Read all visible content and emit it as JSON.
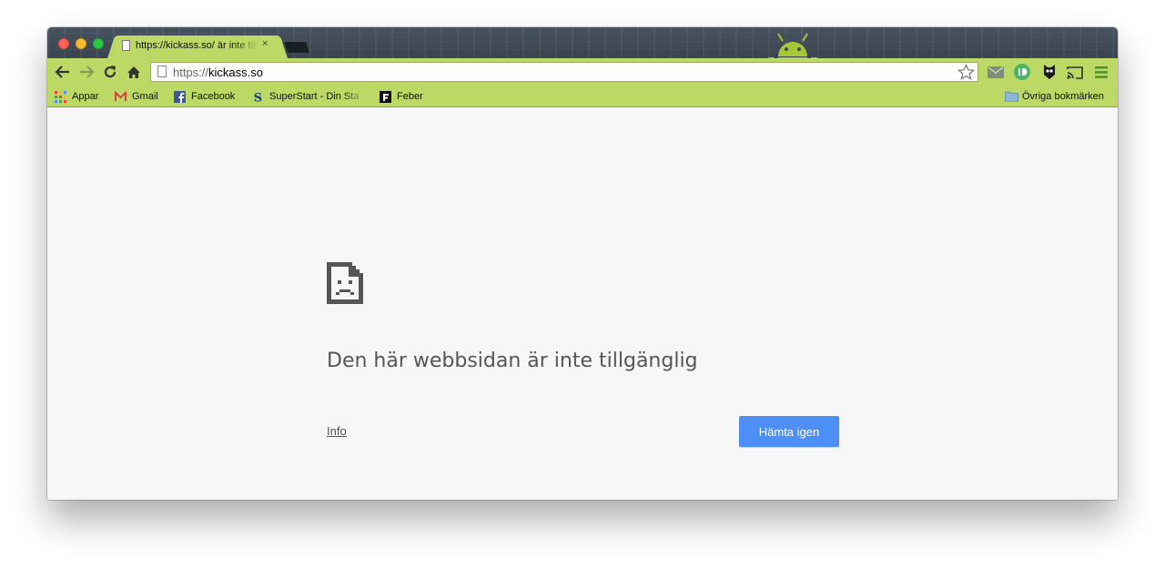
{
  "browser": {
    "tab": {
      "title": "https://kickass.so/ är inte tillgänglig",
      "close_label": "×"
    },
    "address_bar": {
      "scheme": "https://",
      "host": "kickass.so"
    },
    "toolbar_icons": [
      "back-arrow-icon",
      "forward-arrow-icon",
      "reload-icon",
      "home-icon",
      "star-icon",
      "gmail-checker-icon",
      "pushbullet-icon",
      "hootsuite-owl-icon",
      "cast-icon",
      "menu-icon"
    ],
    "bookmarks": [
      {
        "label": "Appar",
        "icon": "apps-grid-icon"
      },
      {
        "label": "Gmail",
        "icon": "gmail-icon"
      },
      {
        "label": "Facebook",
        "icon": "facebook-icon"
      },
      {
        "label": "SuperStart - Din Sta",
        "icon": "superstart-icon"
      },
      {
        "label": "Feber",
        "icon": "feber-icon"
      }
    ],
    "other_bookmarks": {
      "label": "Övriga bokmärken",
      "icon": "folder-icon"
    }
  },
  "error_page": {
    "heading": "Den här webbsidan är inte tillgänglig",
    "info_link": "Info",
    "reload_button": "Hämta igen",
    "icon": "sad-page-icon"
  },
  "colors": {
    "theme_green": "#bcd865",
    "tabstrip_dark": "#3f4a55",
    "button_blue": "#4d8ff5",
    "page_background": "#f7f7f7"
  }
}
